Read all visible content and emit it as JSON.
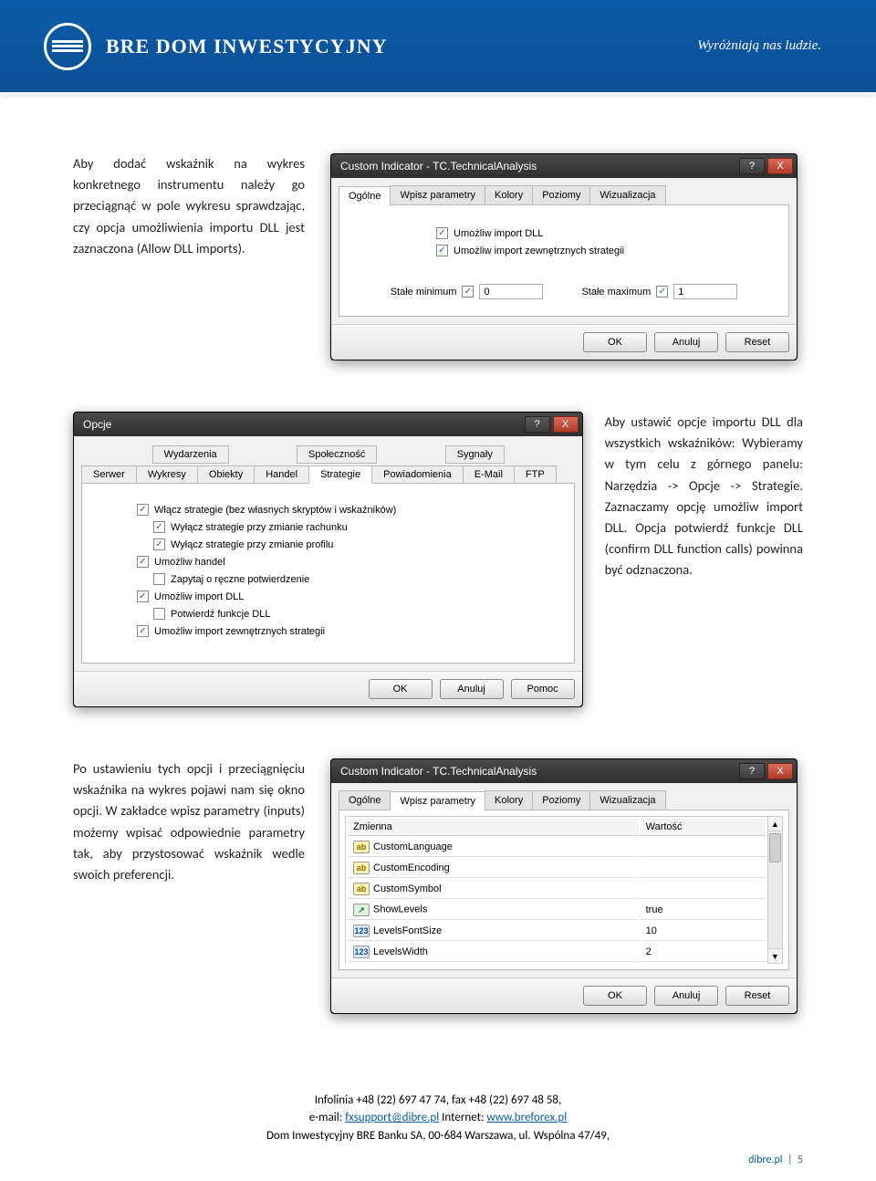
{
  "header": {
    "brand": "BRE DOM INWESTYCYJNY",
    "tagline": "Wyróżniają nas ludzie."
  },
  "section1": {
    "text": "Aby dodać wskaźnik na wykres konkretnego instrumentu należy go przeciągnąć w pole wykresu sprawdzając, czy opcja umożliwienia importu DLL jest zaznaczona (Allow DLL imports).",
    "win": {
      "title": "Custom Indicator - TC.TechnicalAnalysis",
      "tabs": [
        "Ogólne",
        "Wpisz parametry",
        "Kolory",
        "Poziomy",
        "Wizualizacja"
      ],
      "chk1": "Umożliw import DLL",
      "chk2": "Umożliw import zewnętrznych strategii",
      "min_label": "Stałe minimum",
      "min_val": "0",
      "max_label": "Stałe maximum",
      "max_val": "1",
      "buttons": [
        "OK",
        "Anuluj",
        "Reset"
      ]
    }
  },
  "section2": {
    "text": "Aby ustawić opcje importu DLL dla wszystkich wskaźników: Wybieramy w tym celu z górnego panelu: Narzędzia -> Opcje -> Strategie. Zaznaczamy opcję umożliw import DLL. Opcja potwierdź funkcje DLL (confirm DLL function calls) powinna być odznaczona.",
    "win": {
      "title": "Opcje",
      "tabs_top": [
        "Wydarzenia",
        "Społeczność",
        "Sygnały"
      ],
      "tabs_bot": [
        "Serwer",
        "Wykresy",
        "Obiekty",
        "Handel",
        "Strategie",
        "Powiadomienia",
        "E-Mail",
        "FTP"
      ],
      "checks": [
        {
          "on": true,
          "label": "Włącz strategie (bez własnych skryptów i wskaźników)"
        },
        {
          "on": true,
          "label": "Wyłącz strategie przy zmianie rachunku"
        },
        {
          "on": true,
          "label": "Wyłącz strategie przy zmianie profilu"
        },
        {
          "on": true,
          "label": "Umożliw handel"
        },
        {
          "on": false,
          "label": "Zapytaj o ręczne potwierdzenie"
        },
        {
          "on": true,
          "label": "Umożliw import DLL"
        },
        {
          "on": false,
          "label": "Potwierdź funkcje DLL"
        },
        {
          "on": true,
          "label": "Umożliw import zewnętrznych strategii"
        }
      ],
      "buttons": [
        "OK",
        "Anuluj",
        "Pomoc"
      ]
    }
  },
  "section3": {
    "text": "Po ustawieniu tych opcji i przeciągnięciu wskaźnika na wykres pojawi nam się okno opcji. W zakładce wpisz parametry (inputs) możemy wpisać odpowiednie parametry tak, aby przystosować wskaźnik wedle swoich preferencji.",
    "win": {
      "title": "Custom Indicator - TC.TechnicalAnalysis",
      "tabs": [
        "Ogólne",
        "Wpisz parametry",
        "Kolory",
        "Poziomy",
        "Wizualizacja"
      ],
      "th1": "Zmienna",
      "th2": "Wartość",
      "rows": [
        {
          "icon": "ab",
          "name": "CustomLanguage",
          "val": ""
        },
        {
          "icon": "ab",
          "name": "CustomEncoding",
          "val": ""
        },
        {
          "icon": "ab",
          "name": "CustomSymbol",
          "val": ""
        },
        {
          "icon": "ln",
          "name": "ShowLevels",
          "val": "true"
        },
        {
          "icon": "num",
          "name": "LevelsFontSize",
          "val": "10"
        },
        {
          "icon": "num",
          "name": "LevelsWidth",
          "val": "2"
        }
      ],
      "buttons": [
        "OK",
        "Anuluj",
        "Reset"
      ]
    }
  },
  "footer": {
    "line1": "Infolinia +48 (22) 697 47 74, fax +48 (22) 697 48 58,",
    "line2a": "e-mail: ",
    "email": "fxsupport@dibre.pl",
    "line2b": " Internet: ",
    "url": "www.breforex.pl",
    "line3": "Dom Inwestycyjny BRE Banku SA, 00-684 Warszawa, ul. Wspólna 47/49,",
    "page_prefix": "dibre.pl",
    "page_num": "5"
  }
}
